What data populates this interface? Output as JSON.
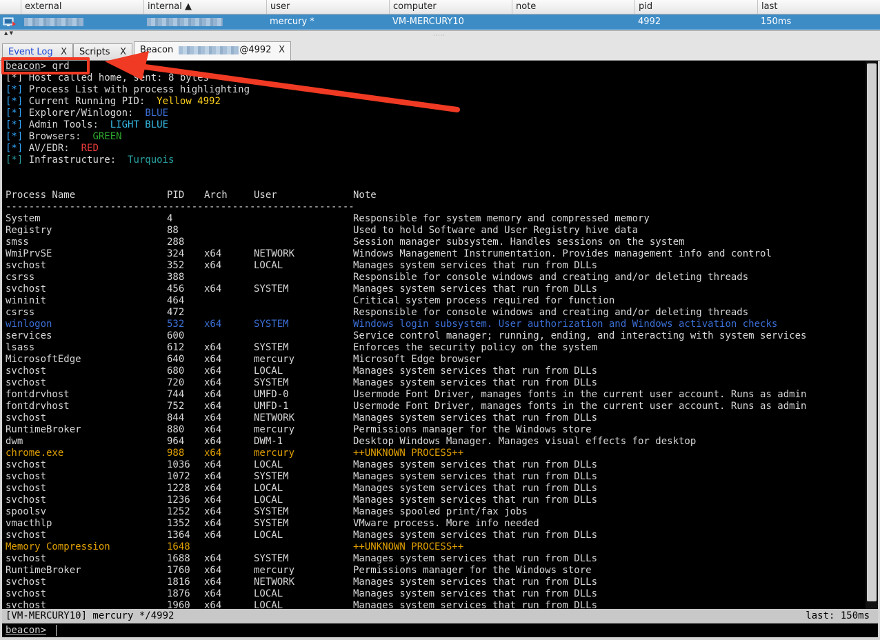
{
  "session_table": {
    "columns": [
      "external",
      "internal ▲",
      "user",
      "computer",
      "note",
      "pid",
      "last"
    ],
    "row": {
      "external": "",
      "internal": "",
      "user": "mercury *",
      "computer": "VM-MERCURY10",
      "note": "",
      "pid": "4992",
      "last": "150ms"
    }
  },
  "tabs": [
    {
      "label": "Event Log",
      "close": "X"
    },
    {
      "label": "Scripts",
      "close": "X"
    },
    {
      "label_prefix": "Beacon",
      "label_suffix": "@4992",
      "close": "X"
    }
  ],
  "console": {
    "command_prompt": "beacon",
    "command_sep": ">",
    "command": " qrd",
    "line_host_called": "[*] Host called home, sent: 8 bytes",
    "info": [
      {
        "tag": "[*]",
        "text": " Process List with process highlighting",
        "value": "",
        "color": ""
      },
      {
        "tag": "[*]",
        "text": " Current Running PID:  ",
        "value": "Yellow 4992",
        "color": "yellow"
      },
      {
        "tag": "[*]",
        "text": " Explorer/Winlogon:  ",
        "value": "BLUE",
        "color": "blue"
      },
      {
        "tag": "[*]",
        "text": " Admin Tools:  ",
        "value": "LIGHT BLUE",
        "color": "lblue"
      },
      {
        "tag": "[*]",
        "text": " Browsers:  ",
        "value": "GREEN",
        "color": "green"
      },
      {
        "tag": "[*]",
        "text": " AV/EDR:  ",
        "value": "RED",
        "color": "red"
      },
      {
        "tag": "[*]",
        "text": " Infrastructure:  ",
        "value": "Turquois",
        "color": "turq"
      }
    ],
    "headers": {
      "name": "Process Name",
      "pid": "PID",
      "arch": "Arch",
      "user": "User",
      "note": "Note"
    },
    "separator": "------------------------------------------------------------",
    "processes": [
      {
        "name": "System",
        "pid": "4",
        "arch": "",
        "user": "",
        "note": "Responsible for system memory and compressed memory",
        "hl": ""
      },
      {
        "name": "Registry",
        "pid": "88",
        "arch": "",
        "user": "",
        "note": "Used to hold Software and User Registry hive data",
        "hl": ""
      },
      {
        "name": "smss",
        "pid": "288",
        "arch": "",
        "user": "",
        "note": "Session manager subsystem. Handles sessions on the system",
        "hl": ""
      },
      {
        "name": "WmiPrvSE",
        "pid": "324",
        "arch": "x64",
        "user": "NETWORK",
        "note": "Windows Management Instrumentation. Provides management info and control",
        "hl": ""
      },
      {
        "name": "svchost",
        "pid": "352",
        "arch": "x64",
        "user": "LOCAL",
        "note": "Manages system services that run from DLLs",
        "hl": ""
      },
      {
        "name": "csrss",
        "pid": "388",
        "arch": "",
        "user": "",
        "note": "Responsible for console windows and creating and/or deleting threads",
        "hl": ""
      },
      {
        "name": "svchost",
        "pid": "456",
        "arch": "x64",
        "user": "SYSTEM",
        "note": "Manages system services that run from DLLs",
        "hl": ""
      },
      {
        "name": "wininit",
        "pid": "464",
        "arch": "",
        "user": "",
        "note": "Critical system process required for function",
        "hl": ""
      },
      {
        "name": "csrss",
        "pid": "472",
        "arch": "",
        "user": "",
        "note": "Responsible for console windows and creating and/or deleting threads",
        "hl": ""
      },
      {
        "name": "winlogon",
        "pid": "532",
        "arch": "x64",
        "user": "SYSTEM",
        "note": "Windows login subsystem. User authorization and Windows activation checks",
        "hl": "blue"
      },
      {
        "name": "services",
        "pid": "600",
        "arch": "",
        "user": "",
        "note": "Service control manager; running, ending, and interacting with system services",
        "hl": ""
      },
      {
        "name": "lsass",
        "pid": "612",
        "arch": "x64",
        "user": "SYSTEM",
        "note": "Enforces the security policy on the system",
        "hl": ""
      },
      {
        "name": "MicrosoftEdge",
        "pid": "640",
        "arch": "x64",
        "user": "mercury",
        "note": "Microsoft Edge browser",
        "hl": ""
      },
      {
        "name": "svchost",
        "pid": "680",
        "arch": "x64",
        "user": "LOCAL",
        "note": "Manages system services that run from DLLs",
        "hl": ""
      },
      {
        "name": "svchost",
        "pid": "720",
        "arch": "x64",
        "user": "SYSTEM",
        "note": "Manages system services that run from DLLs",
        "hl": ""
      },
      {
        "name": "fontdrvhost",
        "pid": "744",
        "arch": "x64",
        "user": "UMFD-0",
        "note": "Usermode Font Driver, manages fonts in the current user account. Runs as admin",
        "hl": ""
      },
      {
        "name": "fontdrvhost",
        "pid": "752",
        "arch": "x64",
        "user": "UMFD-1",
        "note": "Usermode Font Driver, manages fonts in the current user account. Runs as admin",
        "hl": ""
      },
      {
        "name": "svchost",
        "pid": "844",
        "arch": "x64",
        "user": "NETWORK",
        "note": "Manages system services that run from DLLs",
        "hl": ""
      },
      {
        "name": "RuntimeBroker",
        "pid": "880",
        "arch": "x64",
        "user": "mercury",
        "note": "Permissions manager for the Windows store",
        "hl": ""
      },
      {
        "name": "dwm",
        "pid": "964",
        "arch": "x64",
        "user": "DWM-1",
        "note": "Desktop Windows Manager. Manages visual effects for desktop",
        "hl": ""
      },
      {
        "name": "chrome.exe",
        "pid": "988",
        "arch": "x64",
        "user": "mercury",
        "note": "++UNKNOWN PROCESS++",
        "hl": "orange"
      },
      {
        "name": "svchost",
        "pid": "1036",
        "arch": "x64",
        "user": "LOCAL",
        "note": "Manages system services that run from DLLs",
        "hl": ""
      },
      {
        "name": "svchost",
        "pid": "1072",
        "arch": "x64",
        "user": "SYSTEM",
        "note": "Manages system services that run from DLLs",
        "hl": ""
      },
      {
        "name": "svchost",
        "pid": "1228",
        "arch": "x64",
        "user": "LOCAL",
        "note": "Manages system services that run from DLLs",
        "hl": ""
      },
      {
        "name": "svchost",
        "pid": "1236",
        "arch": "x64",
        "user": "LOCAL",
        "note": "Manages system services that run from DLLs",
        "hl": ""
      },
      {
        "name": "spoolsv",
        "pid": "1252",
        "arch": "x64",
        "user": "SYSTEM",
        "note": "Manages spooled print/fax jobs",
        "hl": ""
      },
      {
        "name": "vmacthlp",
        "pid": "1352",
        "arch": "x64",
        "user": "SYSTEM",
        "note": "VMware process. More info needed",
        "hl": ""
      },
      {
        "name": "svchost",
        "pid": "1364",
        "arch": "x64",
        "user": "LOCAL",
        "note": "Manages system services that run from DLLs",
        "hl": ""
      },
      {
        "name": "Memory Compression",
        "pid": "1648",
        "arch": "",
        "user": "",
        "note": "++UNKNOWN PROCESS++",
        "hl": "orange"
      },
      {
        "name": "svchost",
        "pid": "1688",
        "arch": "x64",
        "user": "SYSTEM",
        "note": "Manages system services that run from DLLs",
        "hl": ""
      },
      {
        "name": "RuntimeBroker",
        "pid": "1760",
        "arch": "x64",
        "user": "mercury",
        "note": "Permissions manager for the Windows store",
        "hl": ""
      },
      {
        "name": "svchost",
        "pid": "1816",
        "arch": "x64",
        "user": "NETWORK",
        "note": "Manages system services that run from DLLs",
        "hl": ""
      },
      {
        "name": "svchost",
        "pid": "1876",
        "arch": "x64",
        "user": "LOCAL",
        "note": "Manages system services that run from DLLs",
        "hl": ""
      },
      {
        "name": "svchost",
        "pid": "1960",
        "arch": "x64",
        "user": "LOCAL",
        "note": "Manages system services that run from DLLs",
        "hl": ""
      }
    ]
  },
  "status": {
    "left": "[VM-MERCURY10] mercury */4992",
    "right": "last: 150ms"
  },
  "prompt": {
    "label": "beacon>",
    "value": ""
  },
  "colors": {
    "selection": "#3d8cc6",
    "yellow": "#ffd21c",
    "blue": "#3b6fd6",
    "lblue": "#37bde8",
    "green": "#2ea82e",
    "red": "#e83a3a",
    "turq": "#2aa3a3",
    "orange": "#e0a000",
    "annotation": "#f03a23"
  }
}
